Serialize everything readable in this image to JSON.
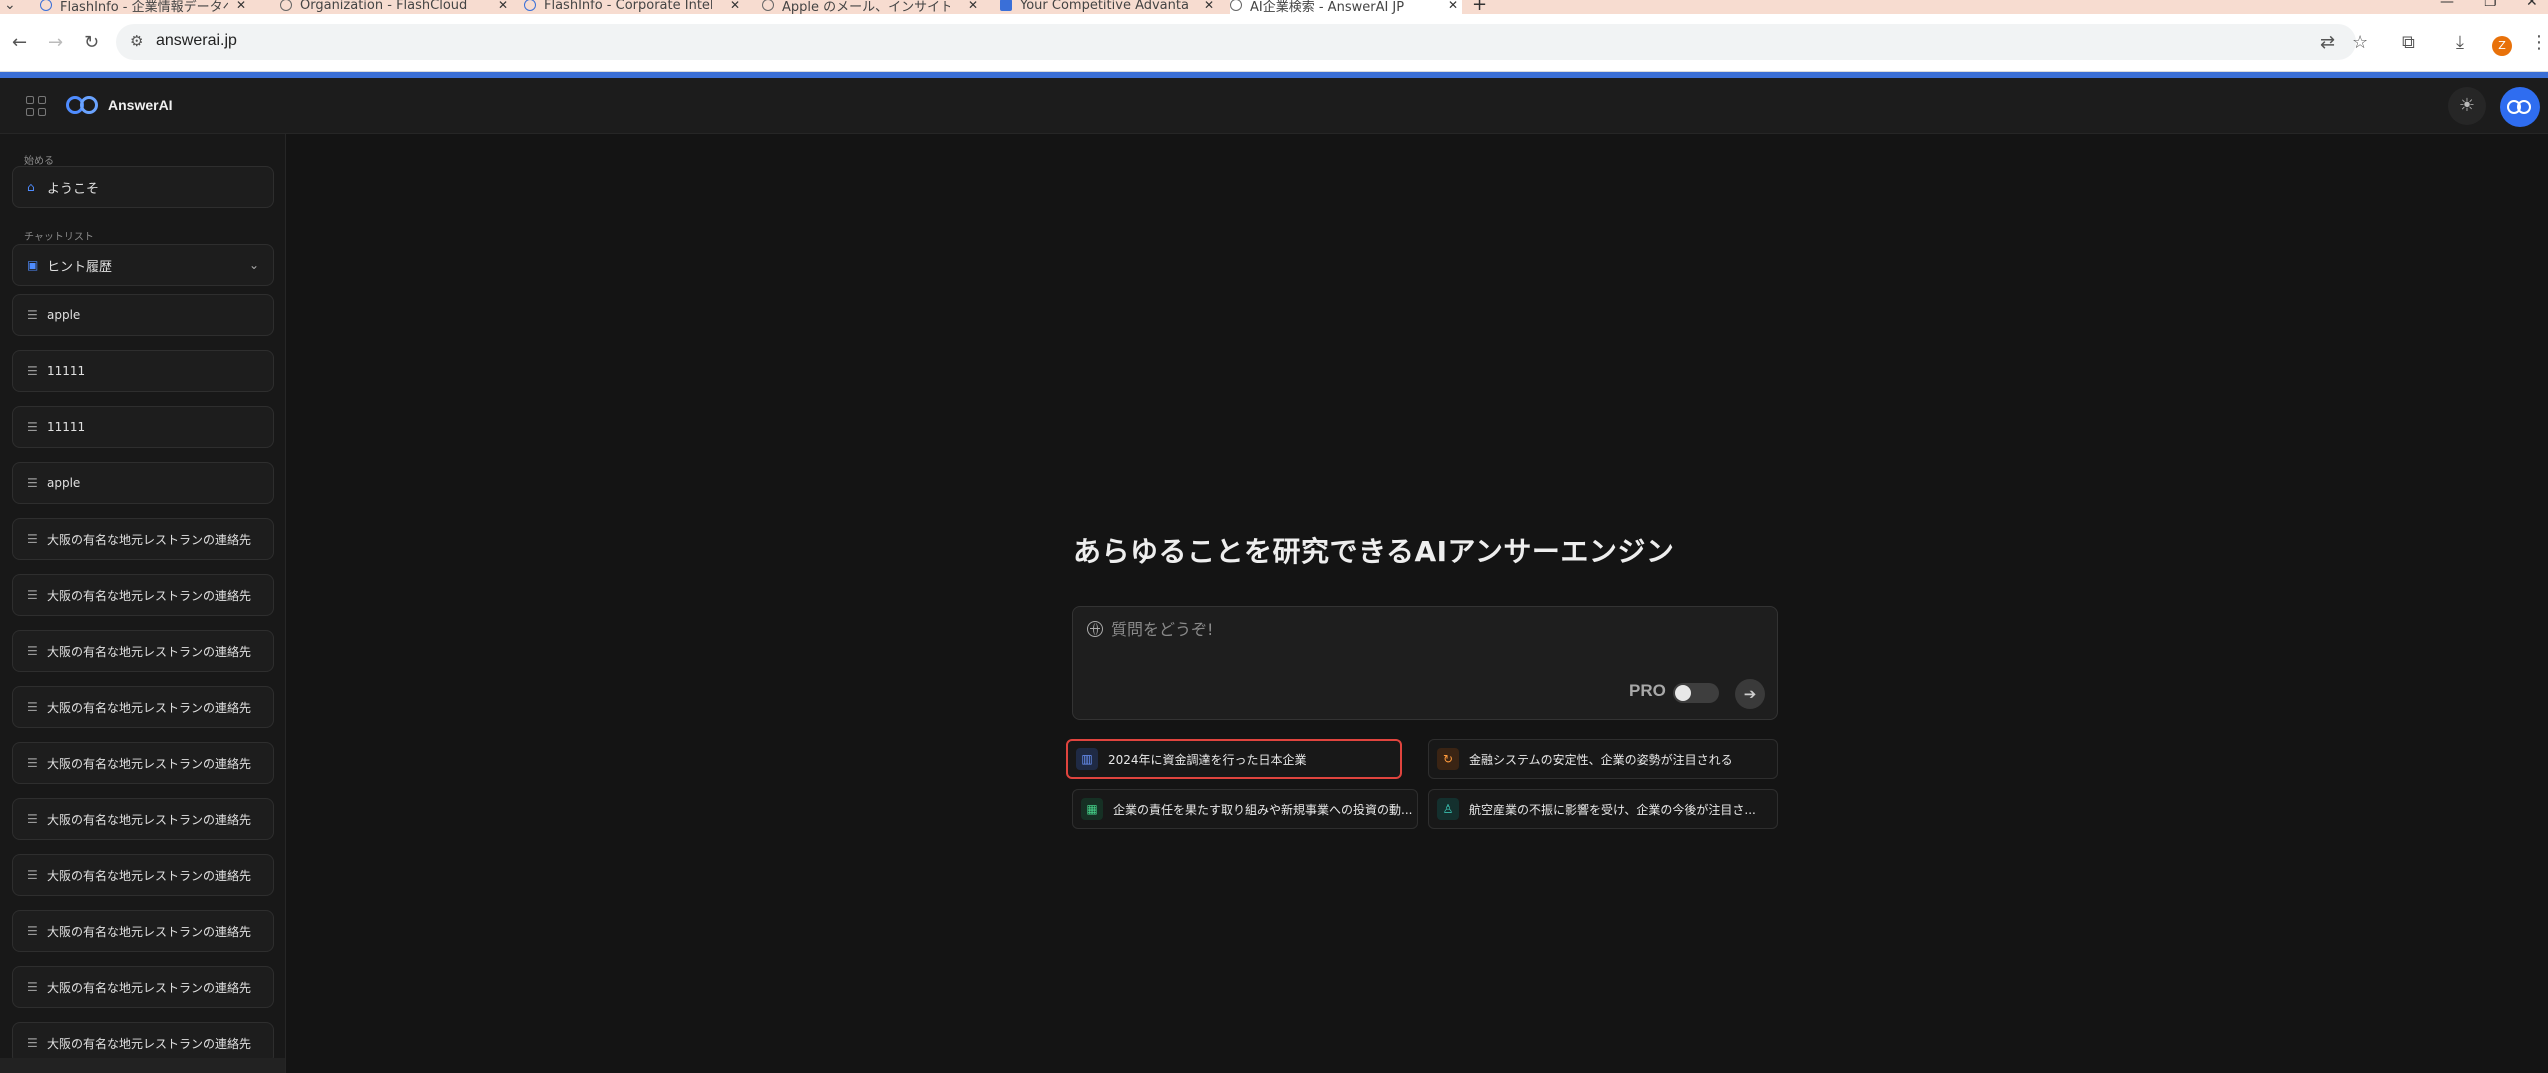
{
  "browser": {
    "tabs": [
      {
        "title": "FlashInfo - 企業情報データベ",
        "active": false
      },
      {
        "title": "Organization - FlashCloud Int",
        "active": false
      },
      {
        "title": "FlashInfo - Corporate Intellig",
        "active": false
      },
      {
        "title": "Apple のメール、インサイト、",
        "active": false
      },
      {
        "title": "Your Competitive Advantage",
        "active": false
      },
      {
        "title": "AI企業検索 - AnswerAI JP",
        "active": true
      }
    ],
    "new_tab": "+",
    "url": "answerai.jp",
    "profile_initial": "Z"
  },
  "app": {
    "logo_text": "AnswerAI",
    "theme_icon": "sun-icon"
  },
  "sidebar": {
    "start_label": "始める",
    "welcome": "ようこそ",
    "chatlist_label": "チャットリスト",
    "history_toggle": "ヒント履歴",
    "history": [
      "apple",
      "11111",
      "11111",
      "apple",
      "大阪の有名な地元レストランの連絡先",
      "大阪の有名な地元レストランの連絡先",
      "大阪の有名な地元レストランの連絡先",
      "大阪の有名な地元レストランの連絡先",
      "大阪の有名な地元レストランの連絡先",
      "大阪の有名な地元レストランの連絡先",
      "大阪の有名な地元レストランの連絡先",
      "大阪の有名な地元レストランの連絡先",
      "大阪の有名な地元レストランの連絡先",
      "大阪の有名な地元レストランの連絡先"
    ]
  },
  "main": {
    "headline": "あらゆることを研究できるAIアンサーエンジン",
    "input_placeholder": "質問をどうぞ!",
    "pro_label": "PRO",
    "pro_enabled": false,
    "send_icon": "arrow-right-icon",
    "suggestions": [
      {
        "text": "2024年に資金調達を行った日本企業",
        "icon": "building-icon",
        "color": "#6d96ff",
        "highlighted": true
      },
      {
        "text": "金融システムの安定性、企業の姿勢が注目される",
        "icon": "refresh-icon",
        "color": "#ff9a3c",
        "highlighted": false
      },
      {
        "text": "企業の責任を果たす取り組みや新規事業への投資の動...",
        "icon": "chart-icon",
        "color": "#45d28a",
        "highlighted": false
      },
      {
        "text": "航空産業の不振に影響を受け、企業の今後が注目さ...",
        "icon": "person-icon",
        "color": "#3fd2c0",
        "highlighted": false
      }
    ]
  }
}
